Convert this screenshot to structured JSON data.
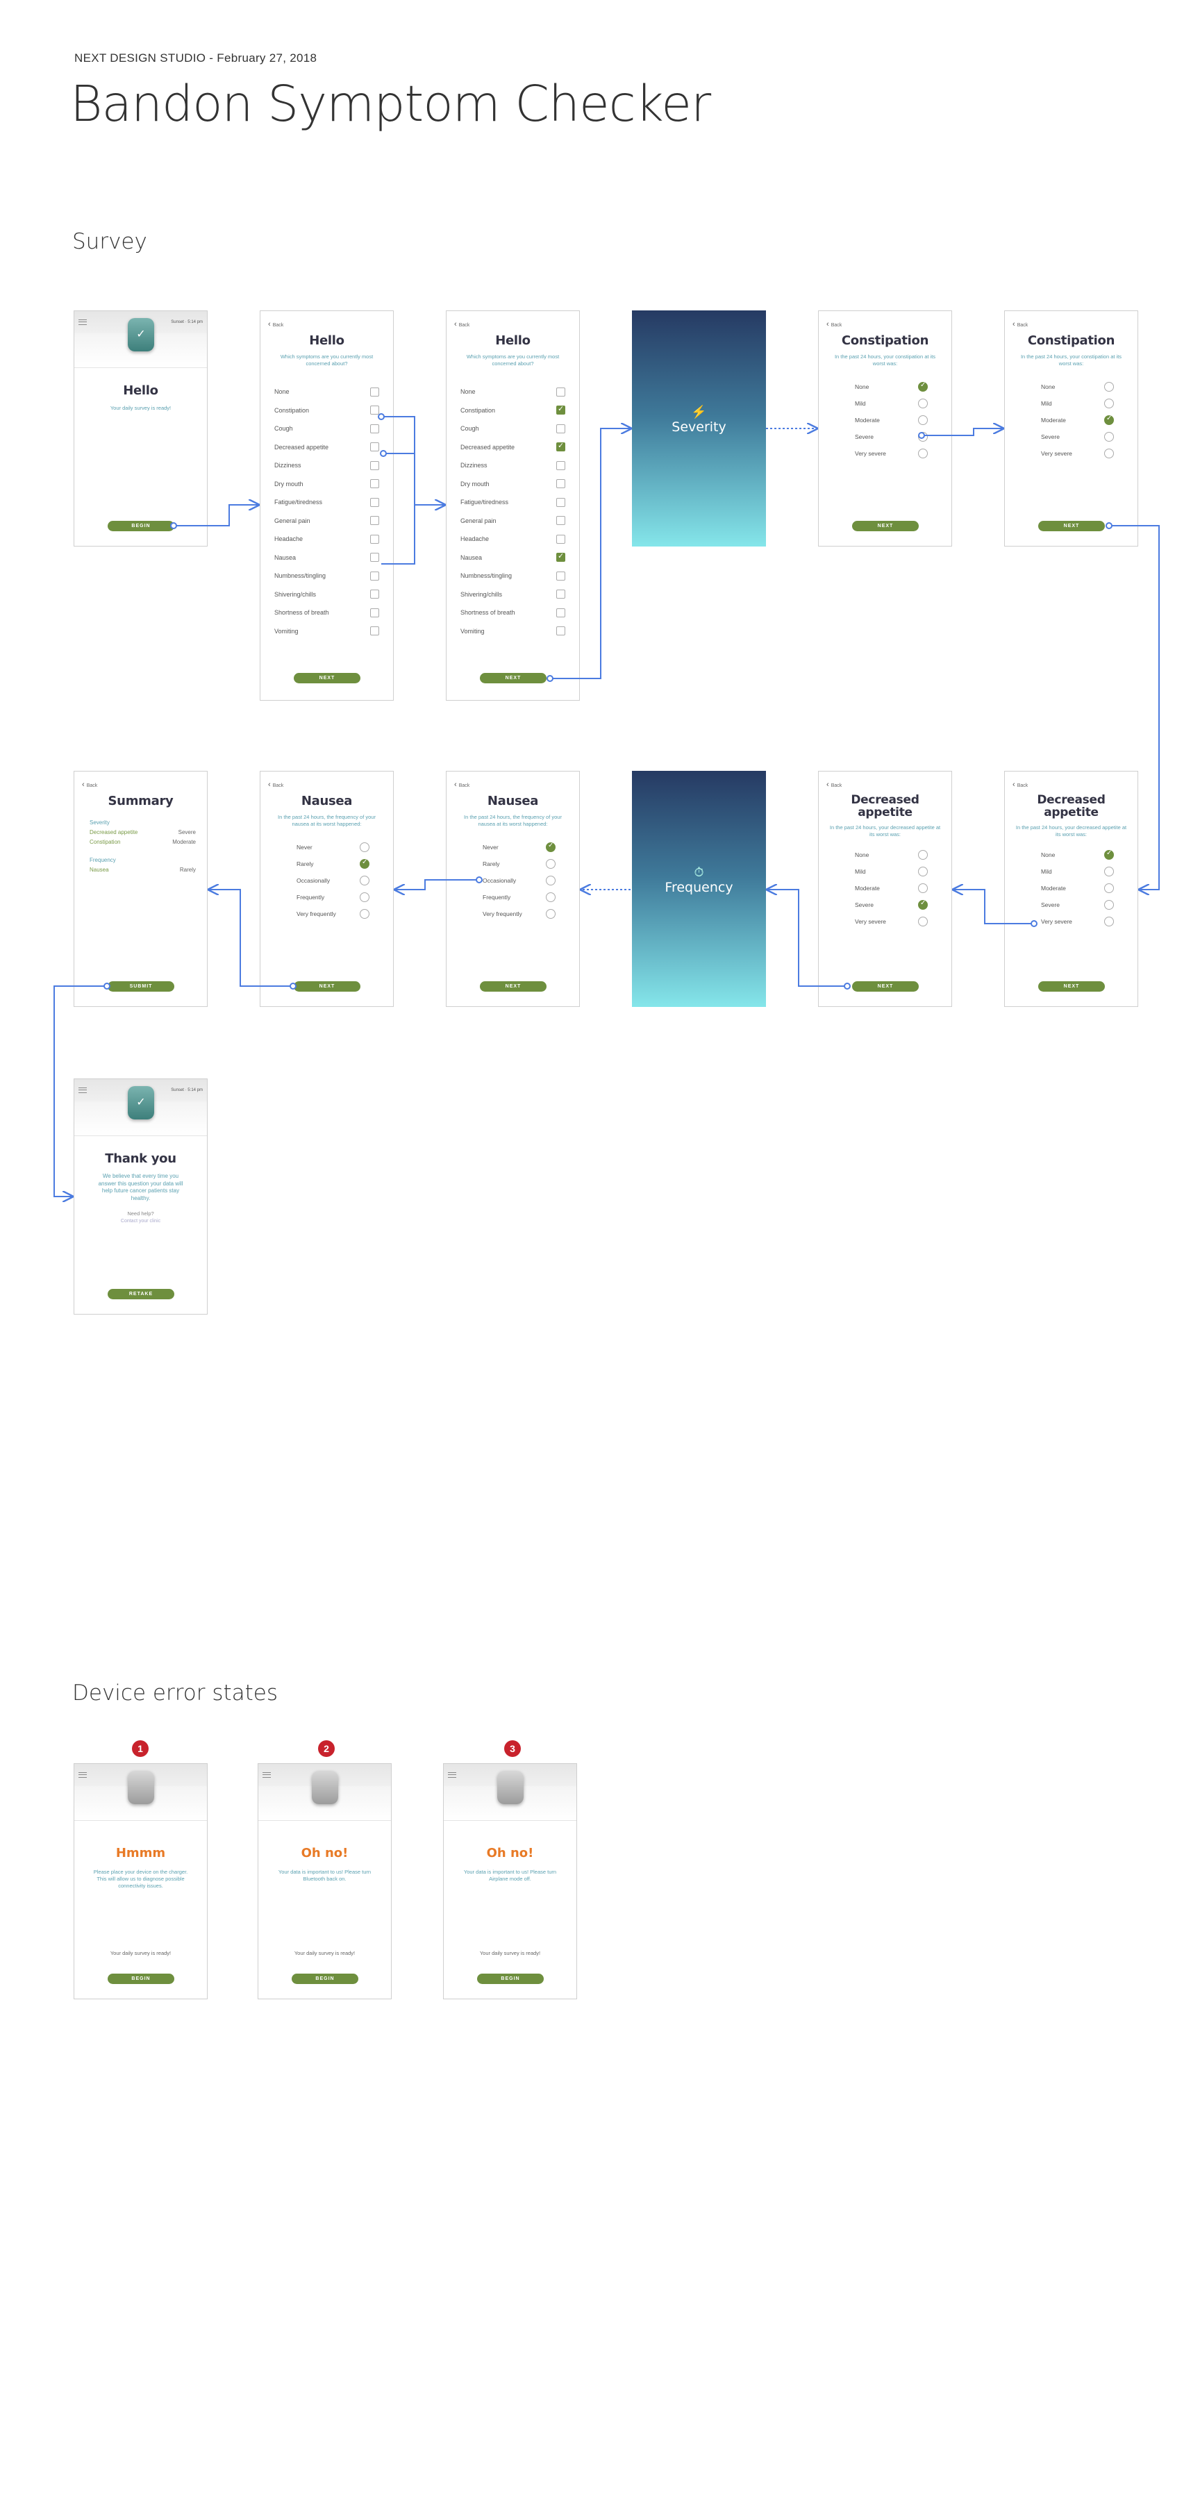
{
  "header": {
    "subtitle": "NEXT DESIGN STUDIO - February 27, 2018",
    "title": "Bandon Symptom Checker"
  },
  "sections": {
    "survey": "Survey",
    "errors": "Device error states"
  },
  "common": {
    "back": "Back",
    "next": "NEXT",
    "begin": "BEGIN",
    "submit": "SUBMIT",
    "retake": "RETAKE",
    "time": "Sunset · 5:14 pm"
  },
  "hello": {
    "title": "Hello",
    "subtitle": "Your daily survey is ready!"
  },
  "symptoms": {
    "title": "Hello",
    "subtitle": "Which symptoms are you currently most concerned about?",
    "items": [
      "None",
      "Constipation",
      "Cough",
      "Decreased appetite",
      "Dizziness",
      "Dry mouth",
      "Fatigue/tiredness",
      "General pain",
      "Headache",
      "Nausea",
      "Numbness/tingling",
      "Shivering/chills",
      "Shortness of breath",
      "Vomiting"
    ],
    "selected": [
      "Constipation",
      "Decreased appetite",
      "Nausea"
    ]
  },
  "severity": {
    "label": "Severity",
    "options": [
      "None",
      "Mild",
      "Moderate",
      "Severe",
      "Very severe"
    ]
  },
  "frequency": {
    "label": "Frequency",
    "options": [
      "Never",
      "Rarely",
      "Occasionally",
      "Frequently",
      "Very frequently"
    ]
  },
  "constipation": {
    "title": "Constipation",
    "subtitle": "In the past 24 hours, your constipation at its worst was:",
    "selected_a": "None",
    "selected_b": "Moderate"
  },
  "appetite": {
    "title": "Decreased appetite",
    "subtitle": "In the past 24 hours, your decreased appetite at its worst was:",
    "selected_a": "None",
    "selected_b": "Severe"
  },
  "nausea": {
    "title": "Nausea",
    "subtitle": "In the past 24 hours, the frequency of your nausea at its worst happened:",
    "selected_a": "Never",
    "selected_b": "Rarely"
  },
  "summary": {
    "title": "Summary",
    "severity_label": "Severity",
    "frequency_label": "Frequency",
    "severity_rows": [
      {
        "name": "Decreased appetite",
        "value": "Severe"
      },
      {
        "name": "Constipation",
        "value": "Moderate"
      }
    ],
    "frequency_rows": [
      {
        "name": "Nausea",
        "value": "Rarely"
      }
    ]
  },
  "thanks": {
    "title": "Thank you",
    "body": "We believe that every time you answer this question your data will help future cancer patients stay healthy.",
    "help": "Need help?",
    "contact": "Contact your clinic"
  },
  "errors": [
    {
      "num": "1",
      "title": "Hmmm",
      "body": "Please place your device on the charger. This will allow us to diagnose possible connectivity issues.",
      "ready": "Your daily survey is ready!"
    },
    {
      "num": "2",
      "title": "Oh no!",
      "body": "Your data is important to us! Please turn Bluetooth back on.",
      "ready": "Your daily survey is ready!"
    },
    {
      "num": "3",
      "title": "Oh no!",
      "body": "Your data is important to us! Please turn Airplane mode off.",
      "ready": "Your daily survey is ready!"
    }
  ]
}
